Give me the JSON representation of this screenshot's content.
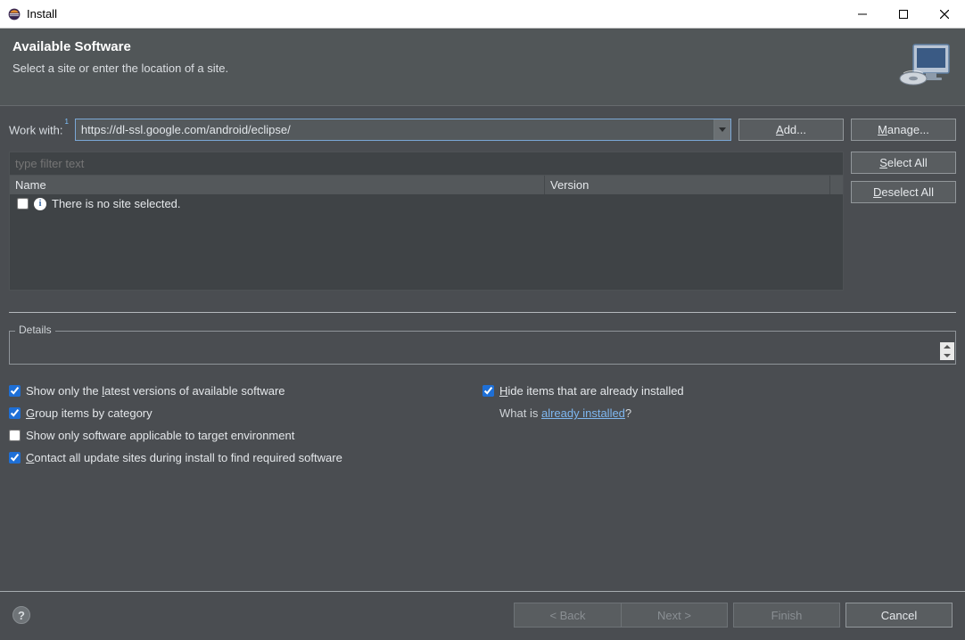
{
  "window": {
    "title": "Install"
  },
  "banner": {
    "heading": "Available Software",
    "subheading": "Select a site or enter the location of a site."
  },
  "workWith": {
    "label": "Work with:",
    "value": "https://dl-ssl.google.com/android/eclipse/"
  },
  "buttons": {
    "add": "Add...",
    "add_ul": "A",
    "manage": "Manage...",
    "manage_ul": "M",
    "selectAll": "Select All",
    "selectAll_ul": "S",
    "deselectAll": "Deselect All",
    "deselectAll_ul": "D"
  },
  "filter": {
    "placeholder": "type filter text"
  },
  "columns": {
    "name": "Name",
    "version": "Version"
  },
  "tree": {
    "emptyMessage": "There is no site selected."
  },
  "details": {
    "legend": "Details",
    "content": ""
  },
  "options": {
    "showLatest": {
      "checked": true,
      "label_pre": "Show only the ",
      "label_ul": "l",
      "label_post": "atest versions of available software"
    },
    "hideInstalled": {
      "checked": true,
      "label_ul": "H",
      "label_post": "ide items that are already installed"
    },
    "groupCategory": {
      "checked": true,
      "label_ul": "G",
      "label_post": "roup items by category"
    },
    "alreadyText_pre": "What is ",
    "alreadyLink": "already installed",
    "alreadyText_post": "?",
    "targetEnv": {
      "checked": false,
      "label": "Show only software applicable to target environment"
    },
    "contactAll": {
      "checked": true,
      "label_ul": "C",
      "label_post": "ontact all update sites during install to find required software"
    }
  },
  "footer": {
    "back": "< Back",
    "next": "Next >",
    "finish": "Finish",
    "cancel": "Cancel"
  }
}
